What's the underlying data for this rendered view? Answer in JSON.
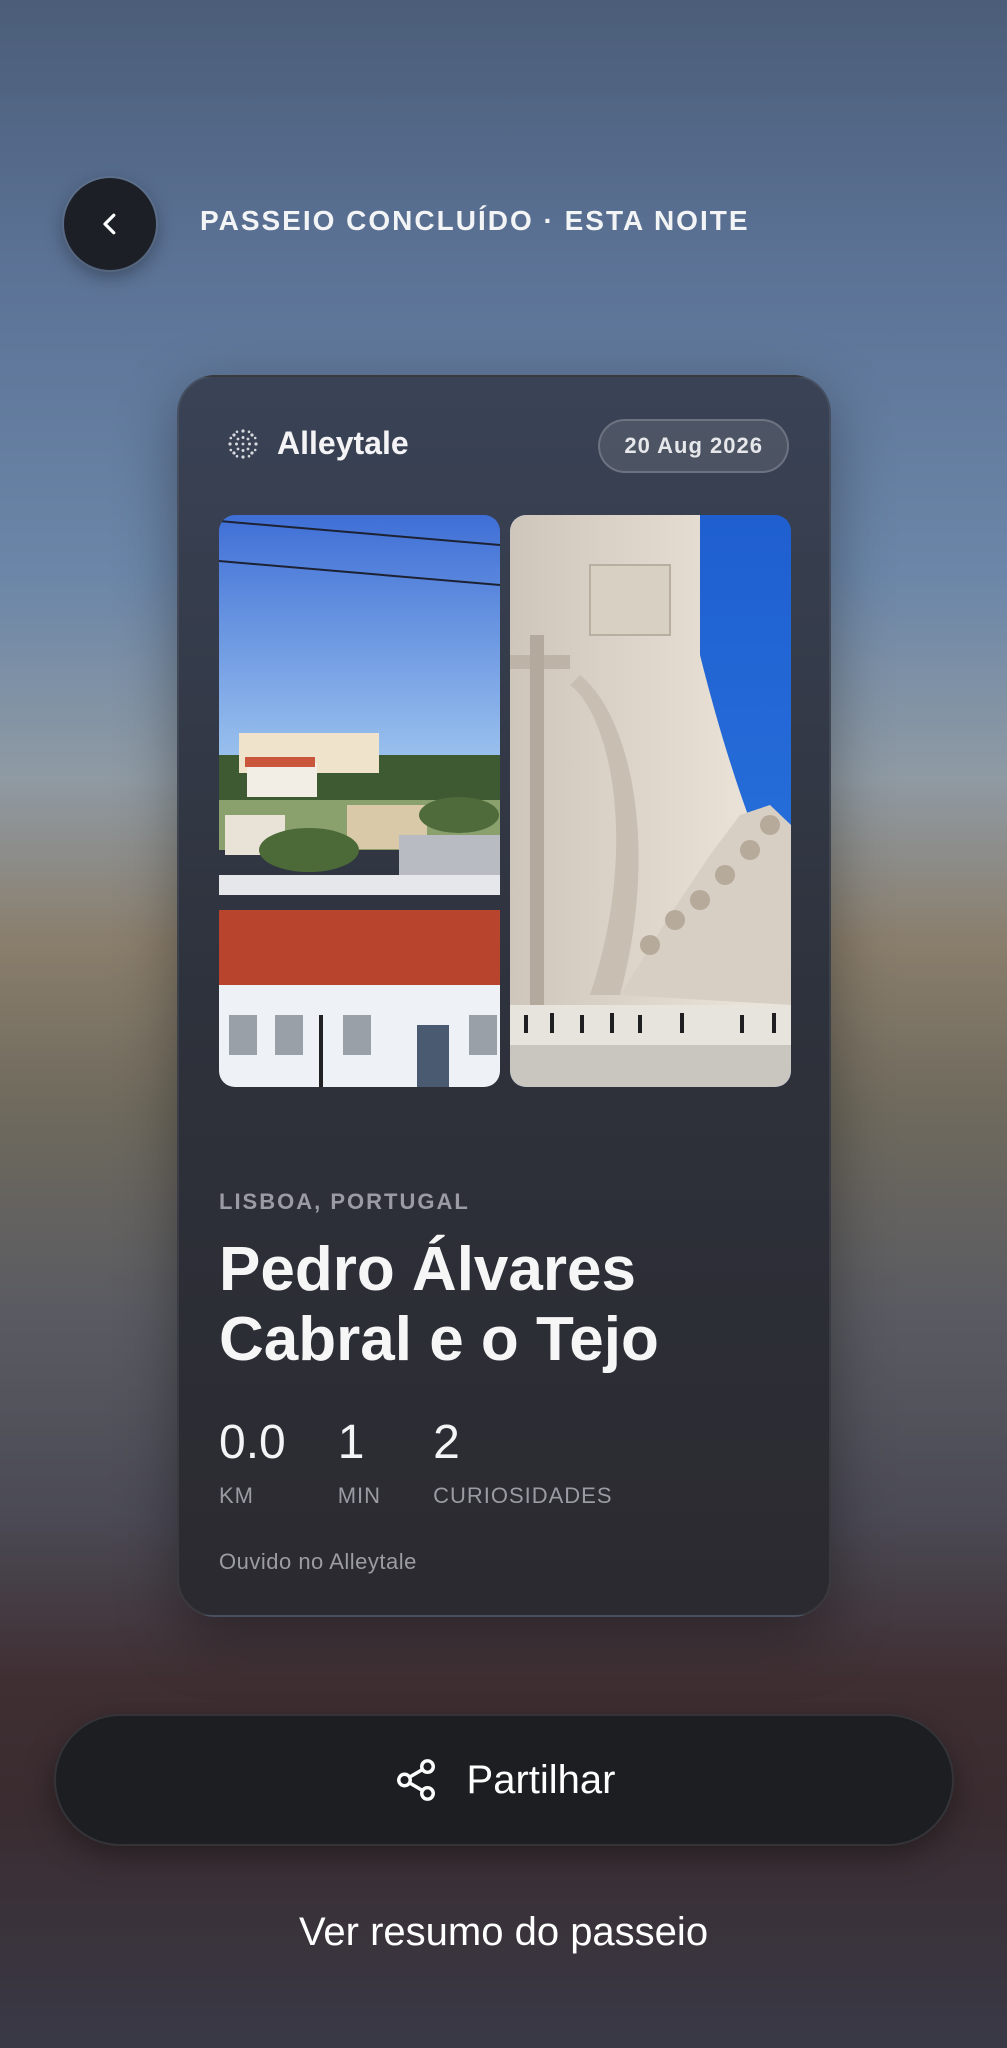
{
  "header": {
    "back_icon": "chevron-left-icon",
    "title": "PASSEIO CONCLUÍDO · ESTA NOITE"
  },
  "card": {
    "brand": {
      "icon": "dotted-globe-icon",
      "name": "Alleytale"
    },
    "date": "20 Aug 2026",
    "photos": [
      {
        "name": "lisbon-rooftops-photo"
      },
      {
        "name": "padrao-dos-descobrimentos-photo"
      }
    ],
    "location": "LISBOA, PORTUGAL",
    "title_line1": "Pedro Álvares",
    "title_line2": "Cabral e o Tejo",
    "stats": [
      {
        "value": "0.0",
        "label": "KM"
      },
      {
        "value": "1",
        "label": "MIN"
      },
      {
        "value": "2",
        "label": "CURIOSIDADES"
      }
    ],
    "footnote": "Ouvido no Alleytale"
  },
  "actions": {
    "share_icon": "share-icon",
    "share_label": "Partilhar",
    "summary_link": "Ver resumo do passeio"
  }
}
